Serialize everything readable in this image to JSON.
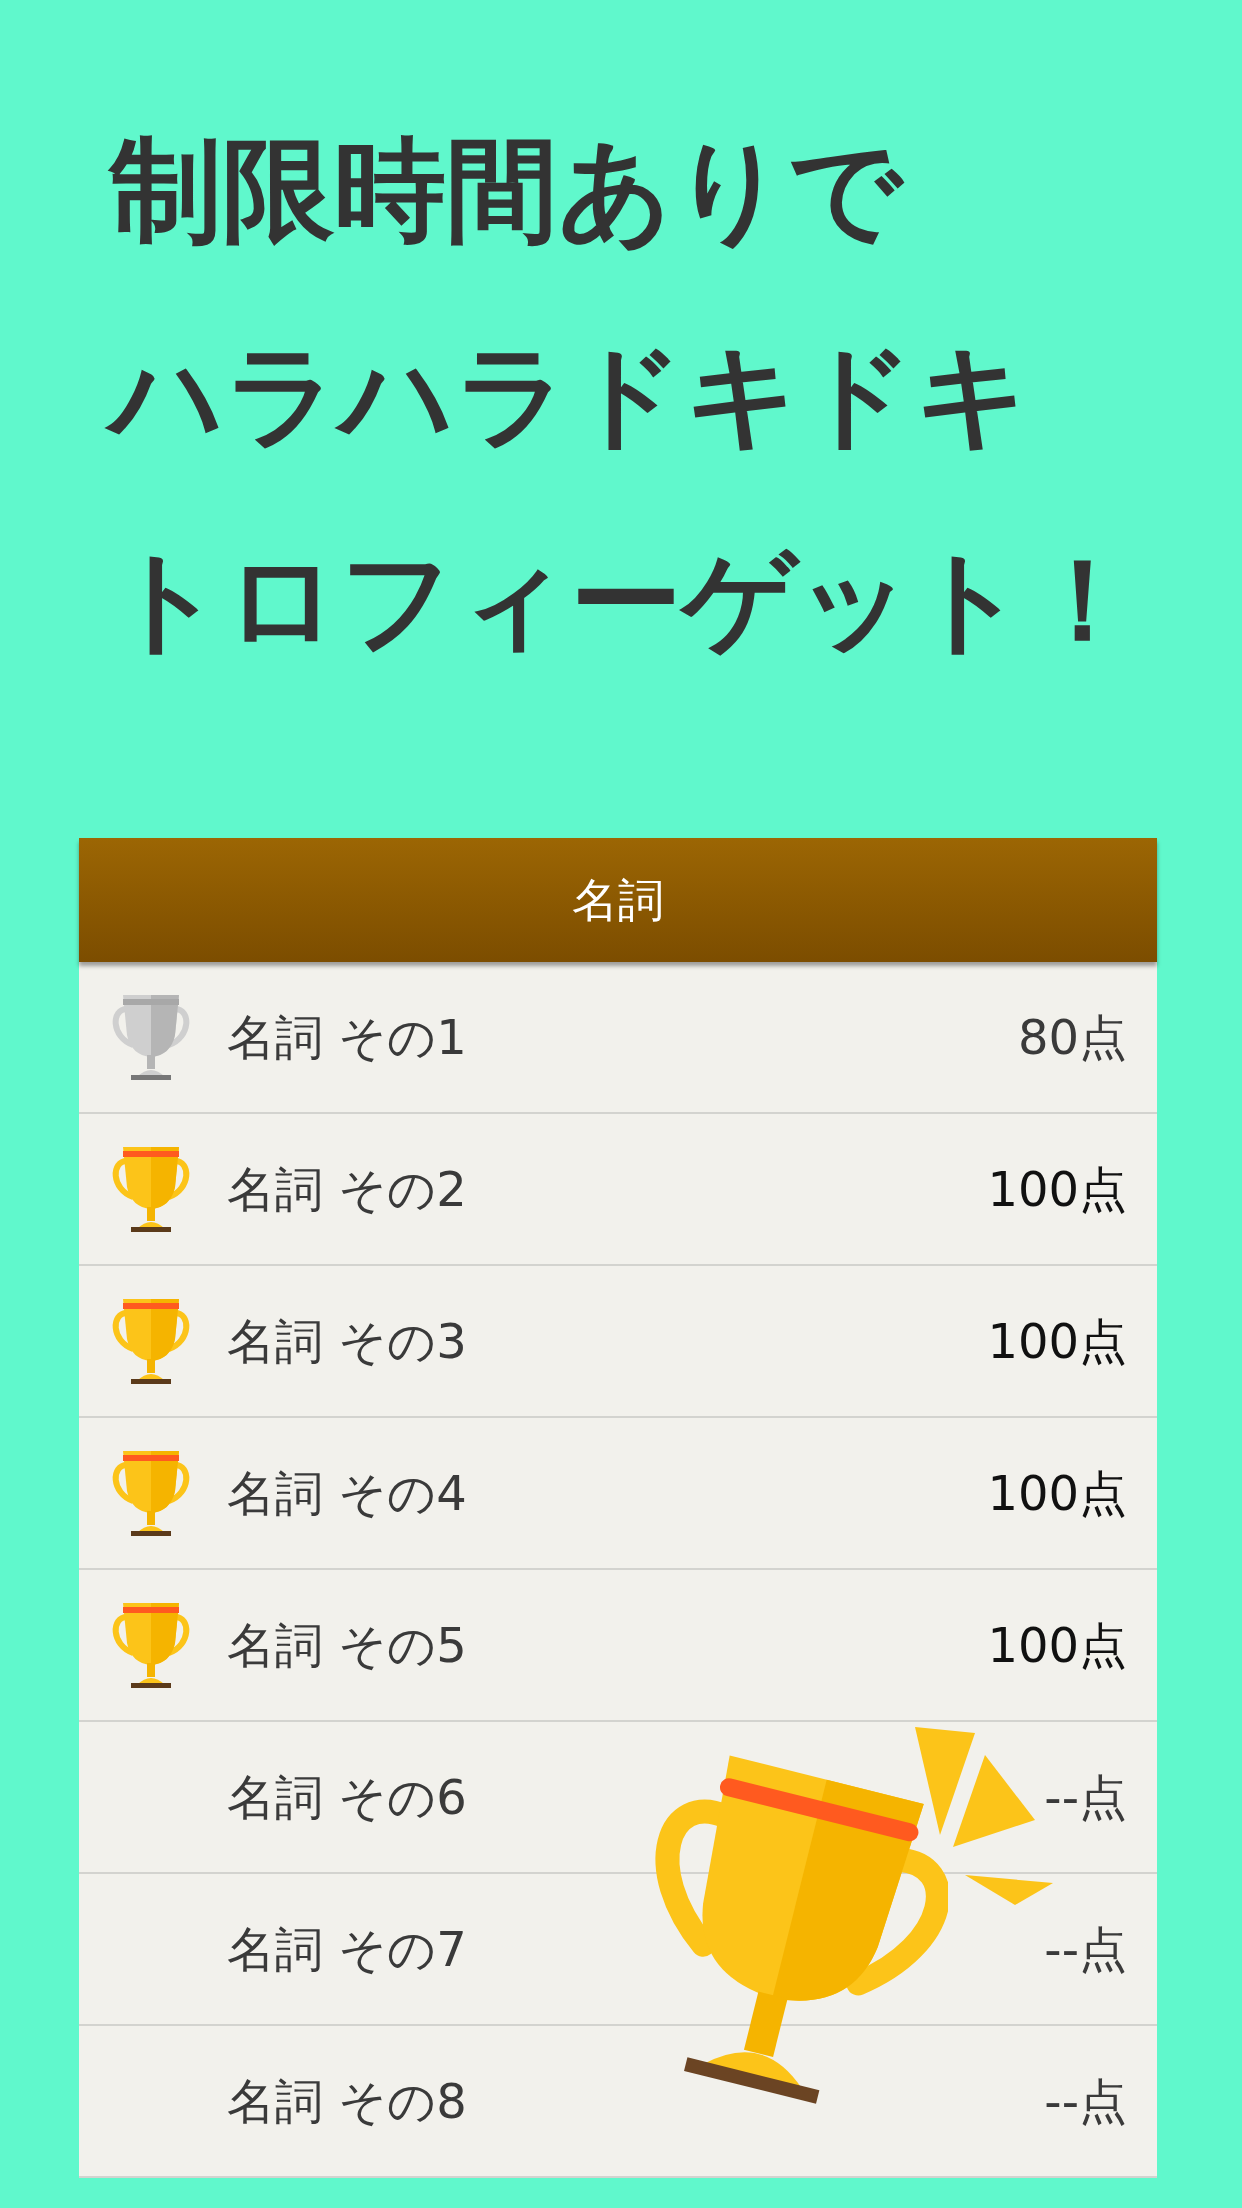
{
  "headline": [
    "制限時間ありで",
    "ハラハラドキドキ",
    "トロフィーゲット！"
  ],
  "list": {
    "title": "名詞",
    "rows": [
      {
        "label": "名詞 その1",
        "score": "80点",
        "kind": "silver"
      },
      {
        "label": "名詞 その2",
        "score": "100点",
        "kind": "gold"
      },
      {
        "label": "名詞 その3",
        "score": "100点",
        "kind": "gold"
      },
      {
        "label": "名詞 その4",
        "score": "100点",
        "kind": "gold"
      },
      {
        "label": "名詞 その5",
        "score": "100点",
        "kind": "gold"
      },
      {
        "label": "名詞 その6",
        "score": "--点",
        "kind": "plain"
      },
      {
        "label": "名詞 その7",
        "score": "--点",
        "kind": "plain"
      },
      {
        "label": "名詞 その8",
        "score": "--点",
        "kind": "plain"
      }
    ]
  }
}
